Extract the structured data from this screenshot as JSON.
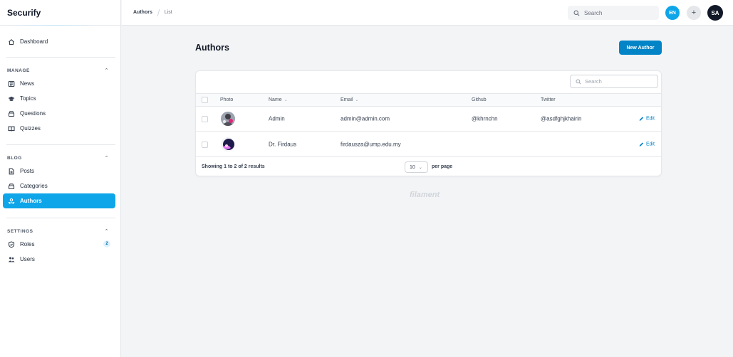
{
  "app": {
    "brand": "Securify"
  },
  "sidebar": {
    "dashboard": "Dashboard",
    "sections": [
      {
        "title": "MANAGE",
        "items": [
          "News",
          "Topics",
          "Questions",
          "Quizzes"
        ]
      },
      {
        "title": "BLOG",
        "items": [
          "Posts",
          "Categories",
          "Authors"
        ]
      },
      {
        "title": "SETTINGS",
        "items": [
          "Roles",
          "Users"
        ]
      }
    ],
    "roles_badge": "2",
    "active_item": "Authors"
  },
  "topbar": {
    "breadcrumb": [
      "Authors",
      "List"
    ],
    "search_placeholder": "Search",
    "language": "EN",
    "add_symbol": "+",
    "user_initials": "SA"
  },
  "page": {
    "title": "Authors",
    "new_button": "New Author"
  },
  "table": {
    "search_placeholder": "Search",
    "columns": [
      "Photo",
      "Name",
      "Email",
      "Github",
      "Twitter"
    ],
    "sortable": [
      "Name",
      "Email"
    ],
    "rows": [
      {
        "name": "Admin",
        "email": "admin@admin.com",
        "github": "@khrnchn",
        "twitter": "@asdfghjkhairin",
        "action": "Edit"
      },
      {
        "name": "Dr. Firdaus",
        "email": "firdausza@ump.edu.my",
        "github": "",
        "twitter": "",
        "action": "Edit"
      }
    ],
    "summary": "Showing 1 to 2 of 2 results",
    "per_page_value": "10",
    "per_page_label": "per page"
  },
  "footer": {
    "brand": "filament"
  },
  "colors": {
    "primary": "#0ea5e9",
    "primary_dark": "#0284c7",
    "background": "#f3f4f6"
  }
}
